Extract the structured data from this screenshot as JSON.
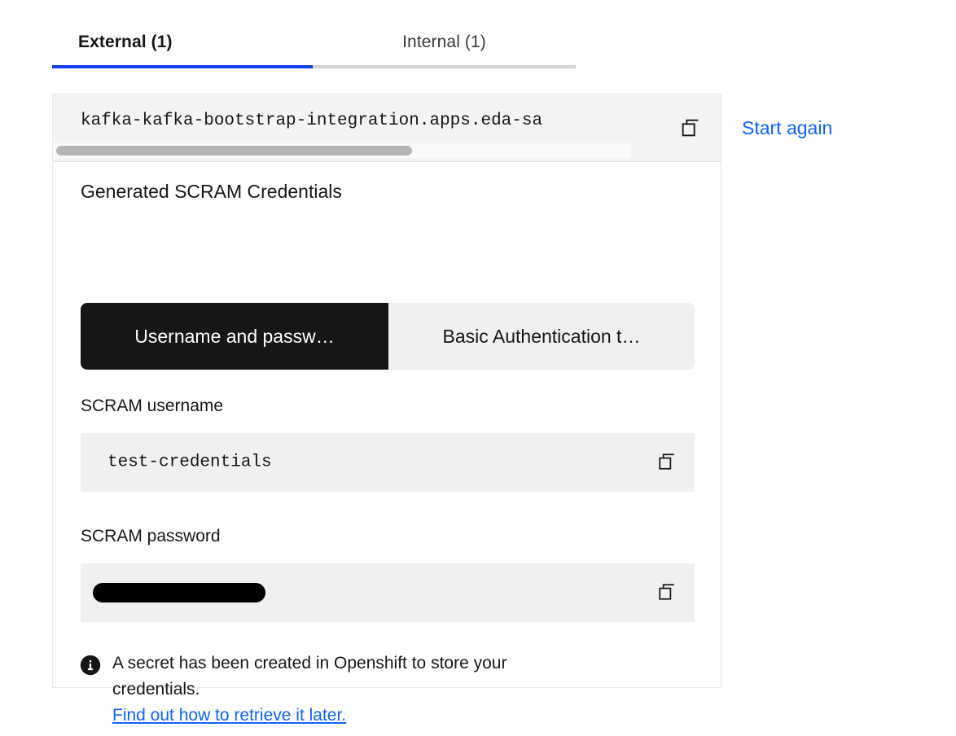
{
  "tabs": [
    {
      "label": "External (1)",
      "active": true
    },
    {
      "label": "Internal (1)",
      "active": false
    }
  ],
  "bootstrap": {
    "value": "kafka-kafka-bootstrap-integration.apps.eda-sa",
    "copy_icon": "copy-icon"
  },
  "start_again": {
    "label": "Start again"
  },
  "credentials": {
    "section_title": "Generated SCRAM Credentials",
    "switcher": [
      {
        "label": "Username and passw…",
        "selected": true
      },
      {
        "label": "Basic Authentication t…",
        "selected": false
      }
    ],
    "username": {
      "label": "SCRAM username",
      "value": "test-credentials",
      "copy_icon": "copy-icon"
    },
    "password": {
      "label": "SCRAM password",
      "value": "",
      "redacted": true,
      "copy_icon": "copy-icon"
    }
  },
  "note": {
    "icon": "info-filled-icon",
    "line1": "A secret has been created in Openshift to store your",
    "line2": "credentials.",
    "link": "Find out how to retrieve it later."
  },
  "colors": {
    "accent_blue": "#0f3ff0",
    "link_blue": "#0f62fe",
    "selected_dark": "#161616",
    "field_gray": "#f0f0f0",
    "inactive_underline": "#d4d4d4"
  }
}
